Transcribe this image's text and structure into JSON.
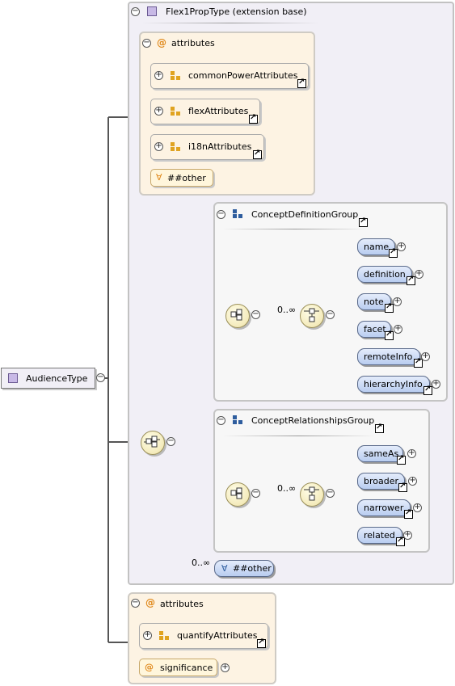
{
  "root": {
    "name": "AudienceType"
  },
  "extension": {
    "title": "Flex1PropType (extension base)"
  },
  "attrs1": {
    "title": "attributes",
    "groups": [
      "commonPowerAttributes",
      "flexAttributes",
      "i18nAttributes"
    ],
    "other": "##other"
  },
  "choice": {
    "group1": {
      "title": "ConceptDefinitionGroup",
      "occurs": "0..∞",
      "elements": [
        "name",
        "definition",
        "note",
        "facet",
        "remoteInfo",
        "hierarchyInfo"
      ]
    },
    "group2": {
      "title": "ConceptRelationshipsGroup",
      "occurs": "0..∞",
      "elements": [
        "sameAs",
        "broader",
        "narrower",
        "related"
      ]
    },
    "any": {
      "occurs": "0..∞",
      "label": "##other"
    }
  },
  "attrs2": {
    "title": "attributes",
    "group": "quantifyAttributes",
    "attribute": "significance"
  },
  "colors": {
    "extension_bg": "#f1eff6",
    "attributes_bg": "#fdf3e3",
    "element_pill": "#c7d7f4",
    "compositor": "#efe3a8",
    "attribute_icon": "#e08a1e"
  }
}
